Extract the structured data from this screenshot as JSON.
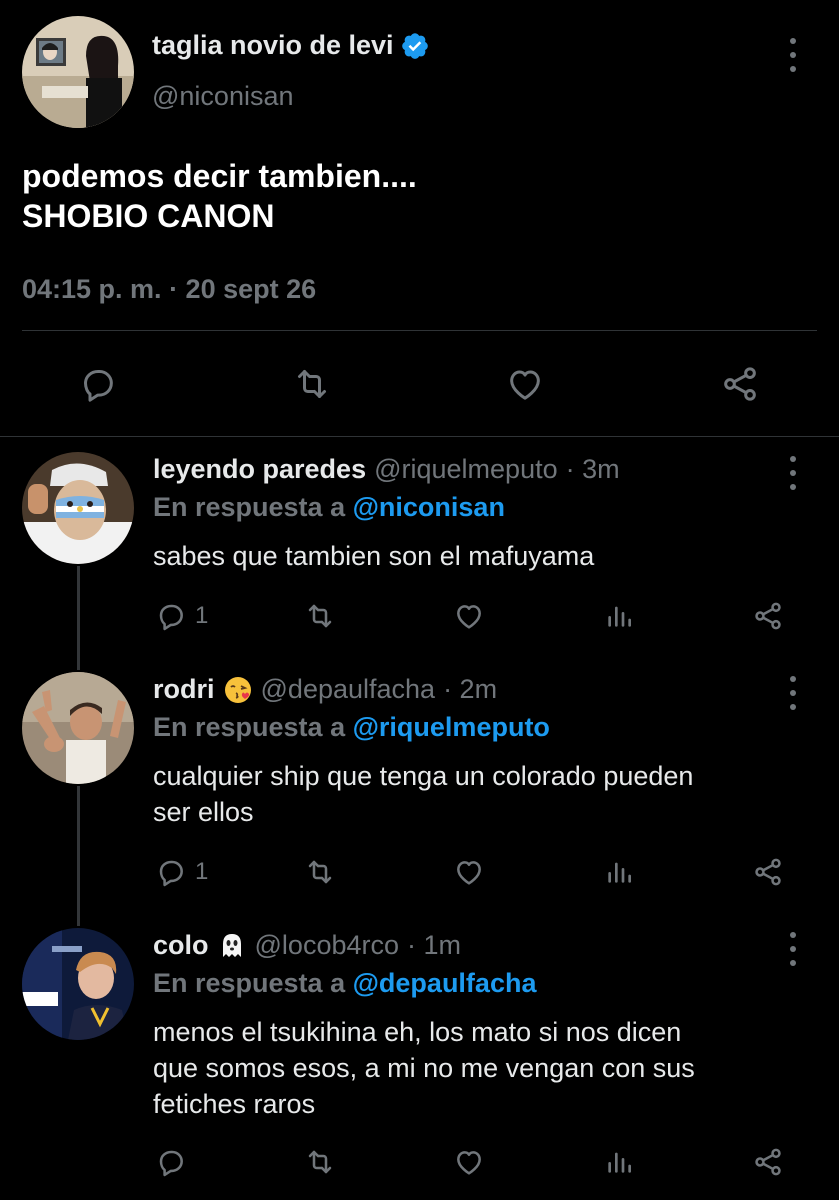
{
  "main_tweet": {
    "display_name": "taglia novio de levi",
    "handle": "@niconisan",
    "text_line1": "podemos decir tambien....",
    "text_line2": "SHOBIO CANON",
    "timestamp": "04:15 p. m. · 20 sept 26"
  },
  "replies": [
    {
      "display_name": "leyendo paredes",
      "handle": "@riquelmeputo",
      "time": "· 3m",
      "reply_prefix": "En respuesta a ",
      "reply_to": "@niconisan",
      "text": "sabes que tambien son el mafuyama",
      "reply_count": "1"
    },
    {
      "display_name": "rodri",
      "handle": "@depaulfacha",
      "time": "· 2m",
      "reply_prefix": "En respuesta a ",
      "reply_to": "@riquelmeputo",
      "text_line1": "cualquier ship que tenga un colorado pueden",
      "text_line2": "ser ellos",
      "reply_count": "1",
      "emoji": "kiss-emoji"
    },
    {
      "display_name": "colo",
      "handle": "@locob4rco",
      "time": "· 1m",
      "reply_prefix": "En respuesta a ",
      "reply_to": "@depaulfacha",
      "text_line1": "menos el tsukihina eh, los mato si nos dicen",
      "text_line2": "que somos esos, a mi no me vengan con sus",
      "text_line3": "fetiches raros",
      "reply_count": "",
      "emoji": "ghost-emoji"
    }
  ],
  "icons": {
    "reply": "speech-bubble-icon",
    "retweet": "retweet-icon",
    "like": "heart-icon",
    "views": "bar-chart-icon",
    "share": "share-icon",
    "more": "vertical-dots-icon",
    "verified": "verified-badge-icon"
  },
  "colors": {
    "background": "#000000",
    "text": "#e7e9ea",
    "secondary": "#71767b",
    "accent": "#1d9bf0"
  }
}
